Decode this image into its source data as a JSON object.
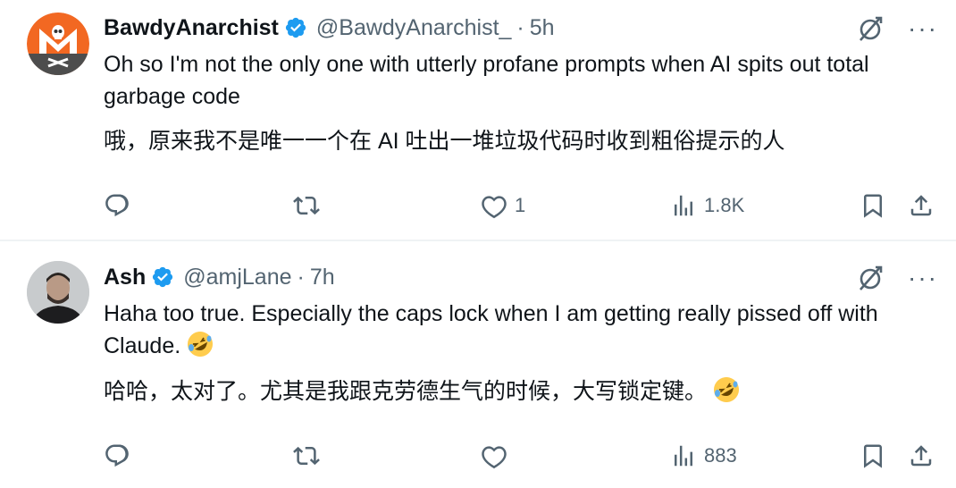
{
  "tweets": [
    {
      "display_name": "BawdyAnarchist",
      "handle": "@BawdyAnarchist_",
      "separator": "·",
      "time": "5h",
      "text_en": "Oh so I'm not the only one with utterly profane prompts when AI spits out total garbage code",
      "text_zh": "哦，原来我不是唯一一个在 AI 吐出一堆垃圾代码时收到粗俗提示的人",
      "reply_count": "",
      "retweet_count": "",
      "like_count": "1",
      "view_count": "1.8K",
      "avatar_icon": "skull-flag-m-logo"
    },
    {
      "display_name": "Ash",
      "handle": "@amjLane",
      "separator": "·",
      "time": "7h",
      "text_en": "Haha too true. Especially the caps lock when I am getting really pissed off with Claude.",
      "text_zh": "哈哈，太对了。尤其是我跟克劳德生气的时候，大写锁定键。",
      "reply_count": "",
      "retweet_count": "",
      "like_count": "",
      "view_count": "883",
      "avatar_icon": "person-photo"
    }
  ],
  "icons": {
    "verified": "verified-badge-icon",
    "grok": "grok-icon",
    "more": "more-icon",
    "reply": "reply-icon",
    "retweet": "retweet-icon",
    "like": "like-icon",
    "views": "views-icon",
    "bookmark": "bookmark-icon",
    "share": "share-icon",
    "emoji": "rolling-on-floor-laughing-emoji"
  },
  "more_glyph": "···",
  "colors": {
    "text": "#0f1419",
    "secondary": "#536471",
    "verified": "#1d9bf0",
    "divider": "#eff3f4",
    "avatar_orange": "#f26822"
  }
}
